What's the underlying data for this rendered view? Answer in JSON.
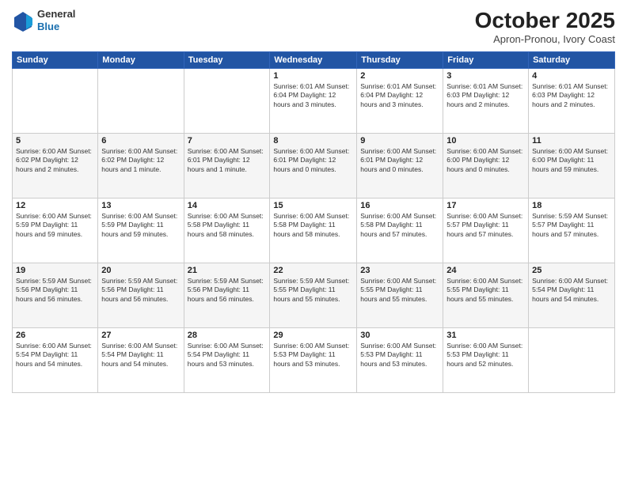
{
  "header": {
    "logo": {
      "general": "General",
      "blue": "Blue"
    },
    "title": "October 2025",
    "location": "Apron-Pronou, Ivory Coast"
  },
  "weekdays": [
    "Sunday",
    "Monday",
    "Tuesday",
    "Wednesday",
    "Thursday",
    "Friday",
    "Saturday"
  ],
  "weeks": [
    [
      {
        "day": "",
        "info": ""
      },
      {
        "day": "",
        "info": ""
      },
      {
        "day": "",
        "info": ""
      },
      {
        "day": "1",
        "info": "Sunrise: 6:01 AM\nSunset: 6:04 PM\nDaylight: 12 hours and 3 minutes."
      },
      {
        "day": "2",
        "info": "Sunrise: 6:01 AM\nSunset: 6:04 PM\nDaylight: 12 hours and 3 minutes."
      },
      {
        "day": "3",
        "info": "Sunrise: 6:01 AM\nSunset: 6:03 PM\nDaylight: 12 hours and 2 minutes."
      },
      {
        "day": "4",
        "info": "Sunrise: 6:01 AM\nSunset: 6:03 PM\nDaylight: 12 hours and 2 minutes."
      }
    ],
    [
      {
        "day": "5",
        "info": "Sunrise: 6:00 AM\nSunset: 6:02 PM\nDaylight: 12 hours and 2 minutes."
      },
      {
        "day": "6",
        "info": "Sunrise: 6:00 AM\nSunset: 6:02 PM\nDaylight: 12 hours and 1 minute."
      },
      {
        "day": "7",
        "info": "Sunrise: 6:00 AM\nSunset: 6:01 PM\nDaylight: 12 hours and 1 minute."
      },
      {
        "day": "8",
        "info": "Sunrise: 6:00 AM\nSunset: 6:01 PM\nDaylight: 12 hours and 0 minutes."
      },
      {
        "day": "9",
        "info": "Sunrise: 6:00 AM\nSunset: 6:01 PM\nDaylight: 12 hours and 0 minutes."
      },
      {
        "day": "10",
        "info": "Sunrise: 6:00 AM\nSunset: 6:00 PM\nDaylight: 12 hours and 0 minutes."
      },
      {
        "day": "11",
        "info": "Sunrise: 6:00 AM\nSunset: 6:00 PM\nDaylight: 11 hours and 59 minutes."
      }
    ],
    [
      {
        "day": "12",
        "info": "Sunrise: 6:00 AM\nSunset: 5:59 PM\nDaylight: 11 hours and 59 minutes."
      },
      {
        "day": "13",
        "info": "Sunrise: 6:00 AM\nSunset: 5:59 PM\nDaylight: 11 hours and 59 minutes."
      },
      {
        "day": "14",
        "info": "Sunrise: 6:00 AM\nSunset: 5:58 PM\nDaylight: 11 hours and 58 minutes."
      },
      {
        "day": "15",
        "info": "Sunrise: 6:00 AM\nSunset: 5:58 PM\nDaylight: 11 hours and 58 minutes."
      },
      {
        "day": "16",
        "info": "Sunrise: 6:00 AM\nSunset: 5:58 PM\nDaylight: 11 hours and 57 minutes."
      },
      {
        "day": "17",
        "info": "Sunrise: 6:00 AM\nSunset: 5:57 PM\nDaylight: 11 hours and 57 minutes."
      },
      {
        "day": "18",
        "info": "Sunrise: 5:59 AM\nSunset: 5:57 PM\nDaylight: 11 hours and 57 minutes."
      }
    ],
    [
      {
        "day": "19",
        "info": "Sunrise: 5:59 AM\nSunset: 5:56 PM\nDaylight: 11 hours and 56 minutes."
      },
      {
        "day": "20",
        "info": "Sunrise: 5:59 AM\nSunset: 5:56 PM\nDaylight: 11 hours and 56 minutes."
      },
      {
        "day": "21",
        "info": "Sunrise: 5:59 AM\nSunset: 5:56 PM\nDaylight: 11 hours and 56 minutes."
      },
      {
        "day": "22",
        "info": "Sunrise: 5:59 AM\nSunset: 5:55 PM\nDaylight: 11 hours and 55 minutes."
      },
      {
        "day": "23",
        "info": "Sunrise: 6:00 AM\nSunset: 5:55 PM\nDaylight: 11 hours and 55 minutes."
      },
      {
        "day": "24",
        "info": "Sunrise: 6:00 AM\nSunset: 5:55 PM\nDaylight: 11 hours and 55 minutes."
      },
      {
        "day": "25",
        "info": "Sunrise: 6:00 AM\nSunset: 5:54 PM\nDaylight: 11 hours and 54 minutes."
      }
    ],
    [
      {
        "day": "26",
        "info": "Sunrise: 6:00 AM\nSunset: 5:54 PM\nDaylight: 11 hours and 54 minutes."
      },
      {
        "day": "27",
        "info": "Sunrise: 6:00 AM\nSunset: 5:54 PM\nDaylight: 11 hours and 54 minutes."
      },
      {
        "day": "28",
        "info": "Sunrise: 6:00 AM\nSunset: 5:54 PM\nDaylight: 11 hours and 53 minutes."
      },
      {
        "day": "29",
        "info": "Sunrise: 6:00 AM\nSunset: 5:53 PM\nDaylight: 11 hours and 53 minutes."
      },
      {
        "day": "30",
        "info": "Sunrise: 6:00 AM\nSunset: 5:53 PM\nDaylight: 11 hours and 53 minutes."
      },
      {
        "day": "31",
        "info": "Sunrise: 6:00 AM\nSunset: 5:53 PM\nDaylight: 11 hours and 52 minutes."
      },
      {
        "day": "",
        "info": ""
      }
    ]
  ]
}
